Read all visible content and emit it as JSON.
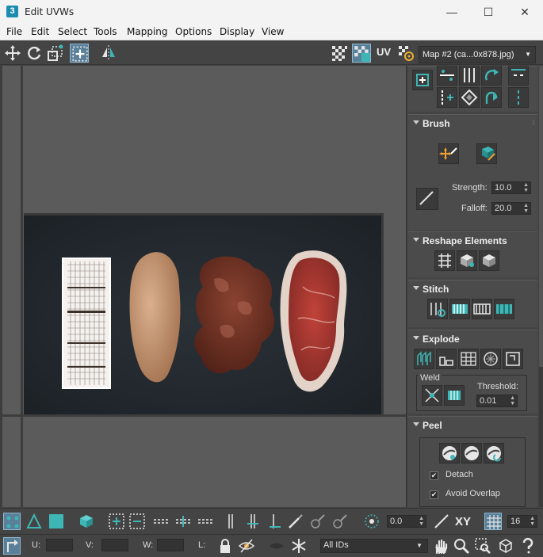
{
  "window": {
    "title": "Edit UVWs",
    "app_icon": "3",
    "minimize_icon": "—",
    "maximize_icon": "☐",
    "close_icon": "✕"
  },
  "menu": [
    "File",
    "Edit",
    "Select",
    "Tools",
    "Mapping",
    "Options",
    "Display",
    "View"
  ],
  "toolbar": {
    "uv_label": "UV",
    "map_dropdown": "Map #2 (ca...0x878.jpg)"
  },
  "brush": {
    "title": "Brush",
    "strength_label": "Strength:",
    "strength_value": "10.0",
    "falloff_label": "Falloff:",
    "falloff_value": "20.0"
  },
  "reshape": {
    "title": "Reshape Elements"
  },
  "stitch": {
    "title": "Stitch"
  },
  "explode": {
    "title": "Explode",
    "weld_label": "Weld",
    "threshold_label": "Threshold:",
    "threshold_value": "0.01"
  },
  "peel": {
    "title": "Peel",
    "detach_label": "Detach",
    "detach_checked": true,
    "avoid_overlap_label": "Avoid Overlap",
    "avoid_overlap_checked": true
  },
  "bottom": {
    "angle_value": "0.0",
    "xy_label": "XY",
    "grid_value": "16",
    "u_label": "U:",
    "v_label": "V:",
    "w_label": "W:",
    "l_label": "L:",
    "ids_dropdown": "All IDs"
  },
  "colors": {
    "accent": "#3fb6b6",
    "selected_bg": "#5a7f98",
    "panel_bg": "#444444",
    "viewport_bg": "#5b5b5b"
  }
}
